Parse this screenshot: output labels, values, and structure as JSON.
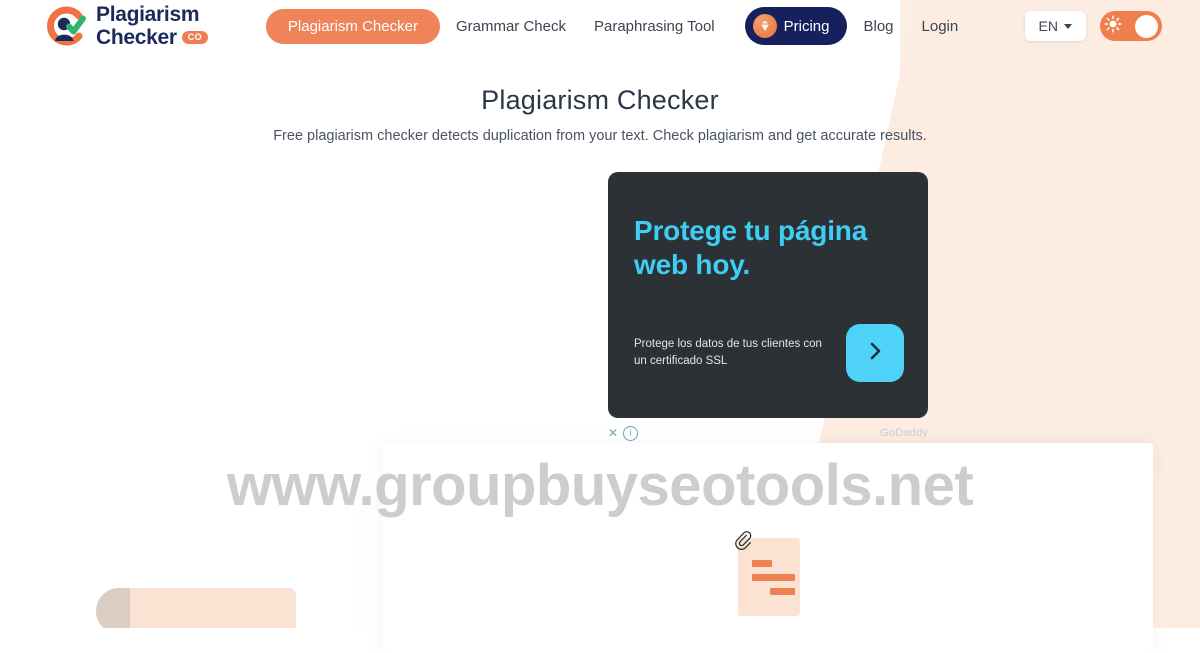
{
  "site": {
    "logo": {
      "line1": "Plagiarism",
      "line2": "Checker",
      "badge": "CO"
    }
  },
  "header": {
    "nav": [
      {
        "label": "Plagiarism Checker",
        "active": true
      },
      {
        "label": "Grammar Check",
        "active": false
      },
      {
        "label": "Paraphrasing Tool",
        "active": false
      }
    ],
    "pricing_label": "Pricing",
    "links": [
      {
        "label": "Blog"
      },
      {
        "label": "Login"
      }
    ],
    "language": {
      "selected": "EN",
      "options": [
        "EN"
      ]
    },
    "theme_toggle": {
      "state": "light",
      "icon": "sun-icon"
    }
  },
  "hero": {
    "title": "Plagiarism Checker",
    "subtitle": "Free plagiarism checker detects duplication from your text. Check plagiarism and get accurate results."
  },
  "ad": {
    "headline": "Protege tu página web hoy.",
    "body": "Protege los datos de tus clientes con un certificado SSL",
    "cta_icon": "chevron-right-icon",
    "close_label": "✕",
    "info_label": "ⓘ",
    "brand": "GoDaddy"
  },
  "main": {
    "upload_icon": "document-attachment-icon"
  },
  "watermark": {
    "text": "www.groupbuyseotools.net"
  },
  "colors": {
    "accent_orange": "#ef8359",
    "navy": "#16205c",
    "ad_background": "#2c3136",
    "ad_cyan": "#3fcdf2",
    "peach_background": "#fdeee4",
    "watermark_gray": "#cdcdcd"
  }
}
